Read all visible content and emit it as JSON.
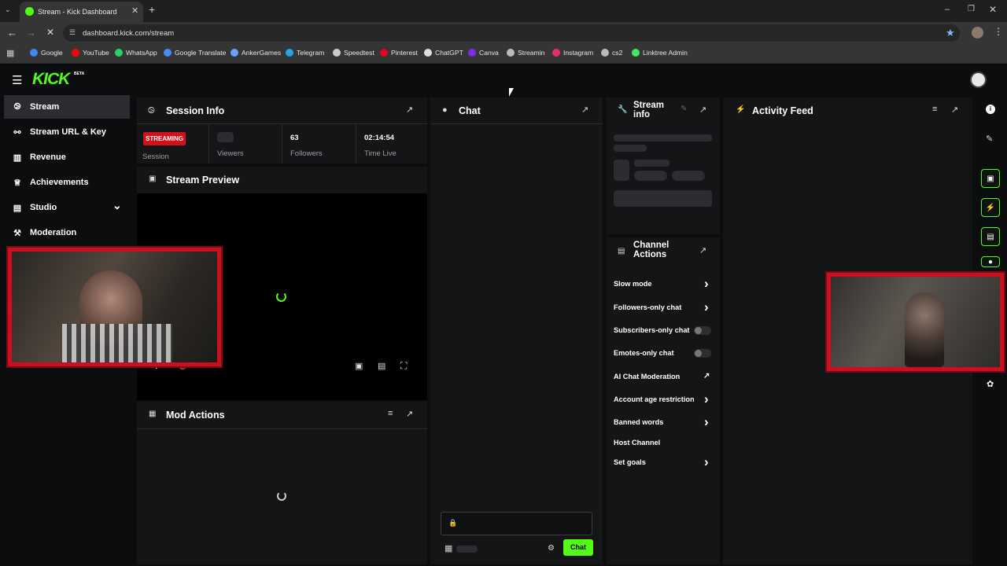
{
  "browser": {
    "tab_title": "Stream - Kick Dashboard",
    "url": "dashboard.kick.com/stream",
    "bookmarks": [
      {
        "label": "Google",
        "color": "#4285f4"
      },
      {
        "label": "YouTube",
        "color": "#ff0000"
      },
      {
        "label": "WhatsApp",
        "color": "#25d366"
      },
      {
        "label": "Google Translate",
        "color": "#4a8af4"
      },
      {
        "label": "AnkerGames",
        "color": "#6aa0ff"
      },
      {
        "label": "Telegram",
        "color": "#2aa3df"
      },
      {
        "label": "Speedtest",
        "color": "#cccccc"
      },
      {
        "label": "Pinterest",
        "color": "#e60023"
      },
      {
        "label": "ChatGPT",
        "color": "#dddddd"
      },
      {
        "label": "Canva",
        "color": "#7d2ae8"
      },
      {
        "label": "Streamin",
        "color": "#bbbbbb"
      },
      {
        "label": "Instagram",
        "color": "#e1306c"
      },
      {
        "label": "cs2",
        "color": "#bbbbbb"
      },
      {
        "label": "Linktree Admin",
        "color": "#43e660"
      }
    ]
  },
  "brand": {
    "logo": "KICK",
    "beta": "BETA",
    "accent": "#53fc18"
  },
  "sidebar": {
    "items": [
      {
        "label": "Stream",
        "icon": "broadcast-icon"
      },
      {
        "label": "Stream URL & Key",
        "icon": "link-icon"
      },
      {
        "label": "Revenue",
        "icon": "chart-icon"
      },
      {
        "label": "Achievements",
        "icon": "trophy-icon"
      },
      {
        "label": "Studio",
        "icon": "studio-icon"
      },
      {
        "label": "Moderation",
        "icon": "wrench-icon"
      }
    ]
  },
  "session": {
    "title": "Session Info",
    "status_badge": "STREAMING",
    "status_label": "Session",
    "viewers_label": "Viewers",
    "followers_value": "63",
    "followers_label": "Followers",
    "time_value": "02:14:54",
    "time_label": "Time Live"
  },
  "preview": {
    "title": "Stream Preview"
  },
  "mod_actions": {
    "title": "Mod Actions"
  },
  "chat": {
    "title": "Chat",
    "send_label": "Chat"
  },
  "stream_info": {
    "title_line1": "Stream",
    "title_line2": "info"
  },
  "channel_actions": {
    "title_line1": "Channel",
    "title_line2": "Actions",
    "rows": [
      {
        "label": "Slow mode",
        "control": "chevron"
      },
      {
        "label": "Followers-only chat",
        "control": "chevron"
      },
      {
        "label": "Subscribers-only chat",
        "control": "toggle"
      },
      {
        "label": "Emotes-only chat",
        "control": "toggle"
      },
      {
        "label": "AI Chat Moderation",
        "control": "external"
      },
      {
        "label": "Account age restriction",
        "control": "chevron"
      },
      {
        "label": "Banned words",
        "control": "chevron"
      },
      {
        "label": "Host Channel",
        "control": "none"
      },
      {
        "label": "Set goals",
        "control": "chevron"
      }
    ]
  },
  "activity": {
    "title": "Activity Feed"
  }
}
